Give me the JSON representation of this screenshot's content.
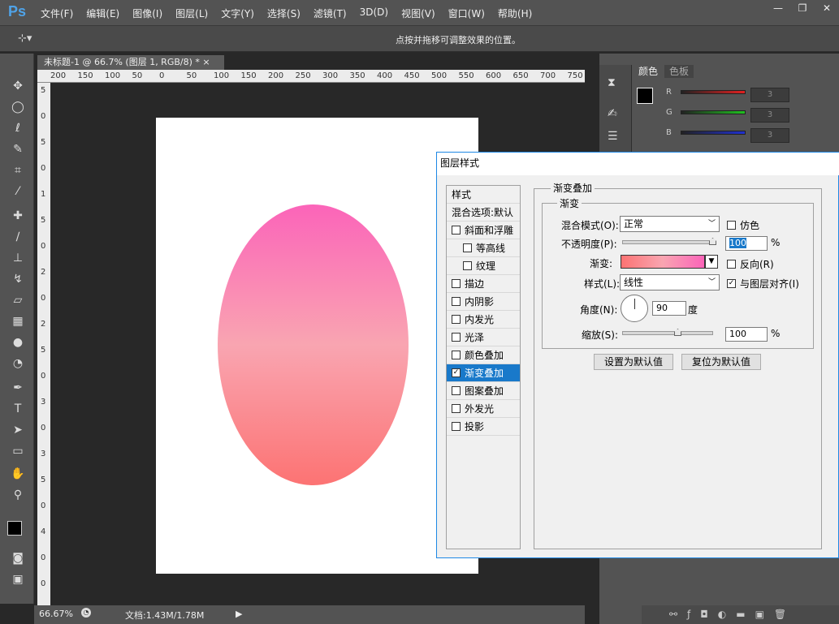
{
  "app": {
    "logo": "Ps",
    "menu": [
      "文件(F)",
      "编辑(E)",
      "图像(I)",
      "图层(L)",
      "文字(Y)",
      "选择(S)",
      "滤镜(T)",
      "3D(D)",
      "视图(V)",
      "窗口(W)",
      "帮助(H)"
    ],
    "window_buttons": [
      "—",
      "❐",
      "✕"
    ]
  },
  "options": {
    "hint": "点按并拖移可调整效果的位置。"
  },
  "document": {
    "tab": "未标题-1 @ 66.7% (图层 1, RGB/8) *",
    "ruler_h": [
      "200",
      "150",
      "100",
      "50",
      "0",
      "50",
      "100",
      "150",
      "200",
      "250",
      "300",
      "350",
      "400",
      "450",
      "500",
      "550",
      "600",
      "650",
      "700",
      "750"
    ],
    "ruler_v": [
      "5",
      "0",
      "5",
      "0",
      "1",
      "5",
      "0",
      "2",
      "0",
      "2",
      "5",
      "0",
      "3",
      "0",
      "3",
      "5",
      "0",
      "4",
      "0",
      "0"
    ],
    "gradient_colors": [
      "#fb64b9",
      "#f9a5b1",
      "#fc7373"
    ]
  },
  "status": {
    "zoom": "66.67%",
    "doc": "文档:1.43M/1.78M"
  },
  "color_panel": {
    "tabs": [
      "颜色",
      "色板"
    ],
    "channels": [
      {
        "label": "R",
        "value": "3",
        "color": "#e02020"
      },
      {
        "label": "G",
        "value": "3",
        "color": "#20c020"
      },
      {
        "label": "B",
        "value": "3",
        "color": "#2030d0"
      }
    ]
  },
  "dialog": {
    "title": "图层样式",
    "styles_header": "样式",
    "blend_default": "混合选项:默认",
    "items": [
      {
        "label": "斜面和浮雕",
        "checked": false,
        "indent": false
      },
      {
        "label": "等高线",
        "checked": false,
        "indent": true
      },
      {
        "label": "纹理",
        "checked": false,
        "indent": true
      },
      {
        "label": "描边",
        "checked": false,
        "indent": false
      },
      {
        "label": "内阴影",
        "checked": false,
        "indent": false
      },
      {
        "label": "内发光",
        "checked": false,
        "indent": false
      },
      {
        "label": "光泽",
        "checked": false,
        "indent": false
      },
      {
        "label": "颜色叠加",
        "checked": false,
        "indent": false
      },
      {
        "label": "渐变叠加",
        "checked": true,
        "indent": false,
        "selected": true
      },
      {
        "label": "图案叠加",
        "checked": false,
        "indent": false
      },
      {
        "label": "外发光",
        "checked": false,
        "indent": false
      },
      {
        "label": "投影",
        "checked": false,
        "indent": false
      }
    ],
    "section_title": "渐变叠加",
    "group_title": "渐变",
    "blend_mode_label": "混合模式(O):",
    "blend_mode": "正常",
    "dither_label": "仿色",
    "opacity_label": "不透明度(P):",
    "opacity": "100",
    "pct": "%",
    "gradient_label": "渐变:",
    "reverse_label": "反向(R)",
    "style_label": "样式(L):",
    "style": "线性",
    "align_label": "与图层对齐(I)",
    "angle_label": "角度(N):",
    "angle": "90",
    "degree": "度",
    "scale_label": "缩放(S):",
    "scale": "100",
    "set_default": "设置为默认值",
    "reset_default": "复位为默认值"
  }
}
